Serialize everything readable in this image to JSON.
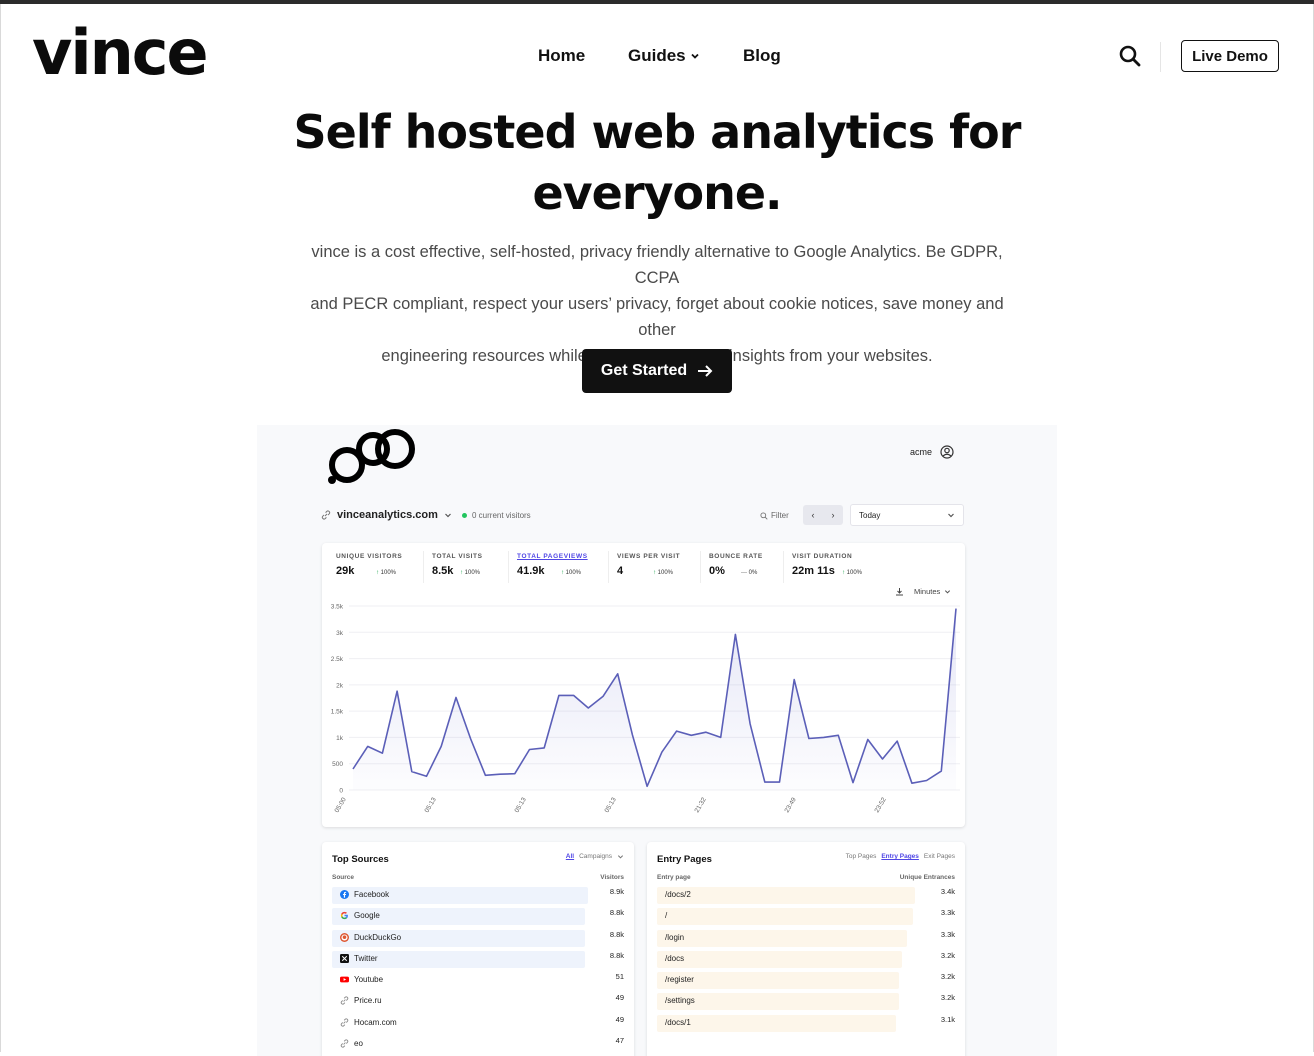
{
  "header": {
    "logo": "vince",
    "nav": {
      "home": "Home",
      "guides": "Guides",
      "blog": "Blog"
    },
    "live_demo": "Live Demo"
  },
  "hero": {
    "title_line1": "Self hosted web analytics for",
    "title_line2": "everyone.",
    "subtitle_line1": "vince is a cost effective, self-hosted, privacy friendly alternative to Google Analytics. Be GDPR, CCPA",
    "subtitle_line2": "and PECR compliant, respect your users’ privacy, forget about cookie notices, save money and other",
    "subtitle_line3": "engineering resources while gaining actionable insights from your websites.",
    "cta": "Get Started"
  },
  "dashboard": {
    "user": "acme",
    "site": "vinceanalytics.com",
    "current_visitors": "0 current visitors",
    "filter": "Filter",
    "period": "Today",
    "granularity": "Minutes",
    "stats": [
      {
        "label": "UNIQUE VISITORS",
        "value": "29k",
        "change": "100%",
        "trend": "up"
      },
      {
        "label": "TOTAL VISITS",
        "value": "8.5k",
        "change": "100%",
        "trend": "up"
      },
      {
        "label": "TOTAL PAGEVIEWS",
        "value": "41.9k",
        "change": "100%",
        "trend": "up",
        "active": true
      },
      {
        "label": "VIEWS PER VISIT",
        "value": "4",
        "change": "100%",
        "trend": "up"
      },
      {
        "label": "BOUNCE RATE",
        "value": "0%",
        "change": "0%",
        "trend": "flat"
      },
      {
        "label": "VISIT DURATION",
        "value": "22m 11s",
        "change": "100%",
        "trend": "up"
      }
    ],
    "top_sources": {
      "title": "Top Sources",
      "tabs": [
        "All",
        "Campaigns"
      ],
      "col_source": "Source",
      "col_visitors": "Visitors",
      "rows": [
        {
          "name": "Facebook",
          "value": "8.9k",
          "fraction": 0.92,
          "icon": "facebook-icon"
        },
        {
          "name": "Google",
          "value": "8.8k",
          "fraction": 0.91,
          "icon": "google-icon"
        },
        {
          "name": "DuckDuckGo",
          "value": "8.8k",
          "fraction": 0.91,
          "icon": "duckduckgo-icon"
        },
        {
          "name": "Twitter",
          "value": "8.8k",
          "fraction": 0.91,
          "icon": "x-twitter-icon"
        },
        {
          "name": "Youtube",
          "value": "51",
          "fraction": 0.0,
          "icon": "youtube-icon"
        },
        {
          "name": "Price.ru",
          "value": "49",
          "fraction": 0.0,
          "icon": "link-icon"
        },
        {
          "name": "Hocam.com",
          "value": "49",
          "fraction": 0.0,
          "icon": "link-icon"
        },
        {
          "name": "eo",
          "value": "47",
          "fraction": 0.0,
          "icon": "link-icon"
        }
      ]
    },
    "entry_pages": {
      "title": "Entry Pages",
      "tabs": [
        "Top Pages",
        "Entry Pages",
        "Exit Pages"
      ],
      "col_page": "Entry page",
      "col_value": "Unique Entrances",
      "rows": [
        {
          "name": "/docs/2",
          "value": "3.4k",
          "fraction": 0.95
        },
        {
          "name": "/",
          "value": "3.3k",
          "fraction": 0.94
        },
        {
          "name": "/login",
          "value": "3.3k",
          "fraction": 0.92
        },
        {
          "name": "/docs",
          "value": "3.2k",
          "fraction": 0.9
        },
        {
          "name": "/register",
          "value": "3.2k",
          "fraction": 0.89
        },
        {
          "name": "/settings",
          "value": "3.2k",
          "fraction": 0.89
        },
        {
          "name": "/docs/1",
          "value": "3.1k",
          "fraction": 0.88
        }
      ]
    }
  },
  "chart_data": {
    "type": "area",
    "title": "",
    "xlabel": "",
    "ylabel": "",
    "ylim": [
      0,
      3500
    ],
    "yticks": [
      "0",
      "500",
      "1k",
      "1.5k",
      "2k",
      "2.5k",
      "3k",
      "3.5k"
    ],
    "xticks": [
      "05:00",
      "05:13",
      "05:13",
      "05:13",
      "21:32",
      "23:49",
      "23:52"
    ],
    "color": "#5b5fb8",
    "values": [
      400,
      830,
      700,
      1880,
      350,
      260,
      830,
      1760,
      970,
      280,
      300,
      310,
      770,
      800,
      1800,
      1800,
      1560,
      1780,
      2210,
      1050,
      70,
      720,
      1120,
      1040,
      1100,
      1000,
      2960,
      1260,
      150,
      150,
      2100,
      980,
      1000,
      1040,
      140,
      960,
      590,
      930,
      130,
      180,
      360,
      3450
    ]
  },
  "colors": {
    "accent": "#4f46e5",
    "line": "#5b5fb8",
    "source_bar": "#eef3fc",
    "entry_bar": "#fdf6ea"
  }
}
